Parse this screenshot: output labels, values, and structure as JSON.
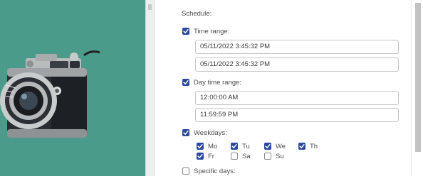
{
  "schedule": {
    "section_label": "Schedule:",
    "time_range": {
      "label": "Time range:",
      "checked": true,
      "from": "05/11/2022 3:45:32 PM",
      "to": "05/11/2022 3:45:32 PM"
    },
    "day_time_range": {
      "label": "Day time range:",
      "checked": true,
      "from": "12:00:00 AM",
      "to": "11:59:59 PM"
    },
    "weekdays": {
      "label": "Weekdays:",
      "checked": true,
      "days": [
        {
          "label": "Mo",
          "checked": true
        },
        {
          "label": "Tu",
          "checked": true
        },
        {
          "label": "We",
          "checked": true
        },
        {
          "label": "Th",
          "checked": true
        },
        {
          "label": "Fr",
          "checked": true
        },
        {
          "label": "Sa",
          "checked": false
        },
        {
          "label": "Su",
          "checked": false
        }
      ]
    },
    "specific_days": {
      "label": "Specific days:",
      "checked": false
    }
  },
  "colors": {
    "checkbox_checked": "#2b4a9e",
    "left_panel_background": "#4a9b89"
  },
  "icons": {
    "check": "check-icon",
    "photo_subject": "camera-icon"
  }
}
